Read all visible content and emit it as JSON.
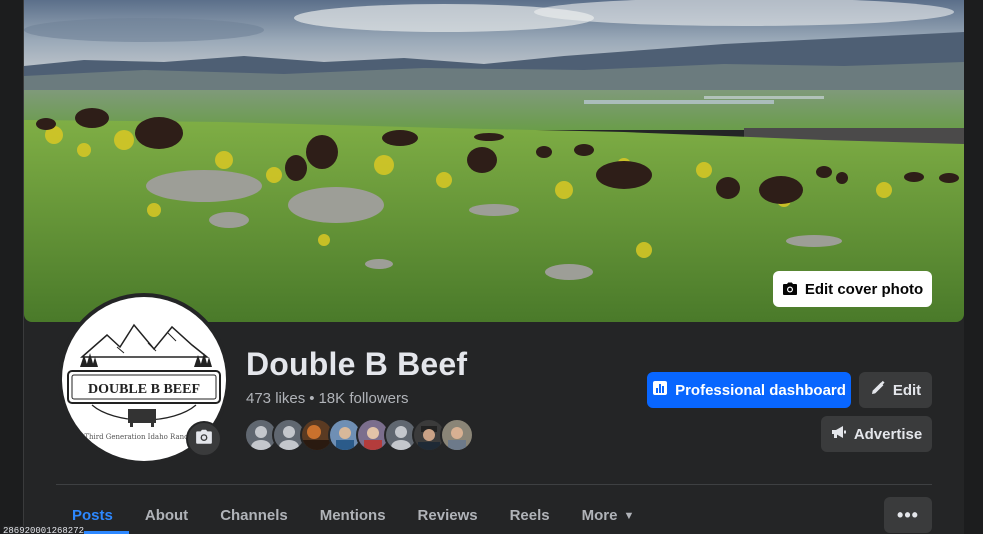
{
  "cover": {
    "edit_label": "Edit cover photo",
    "camera_icon": "camera-icon"
  },
  "profile": {
    "name": "Double B Beef",
    "likes": "473 likes",
    "separator": "•",
    "followers": "18K followers",
    "logo_text": "DOUBLE B BEEF",
    "logo_tagline": "Third Generation Idaho Ranchers",
    "avatar_camera_icon": "camera-icon"
  },
  "actions": {
    "dashboard_label": "Professional dashboard",
    "edit_label": "Edit",
    "advertise_label": "Advertise"
  },
  "tabs": [
    {
      "label": "Posts",
      "active": true
    },
    {
      "label": "About"
    },
    {
      "label": "Channels"
    },
    {
      "label": "Mentions"
    },
    {
      "label": "Reviews"
    },
    {
      "label": "Reels"
    },
    {
      "label": "More"
    }
  ],
  "more_menu": "•••",
  "corner_id": "286920001268272",
  "colors": {
    "background": "#242526",
    "primary": "#0866ff",
    "active_tab": "#2d88ff",
    "secondary_button": "#3a3b3c"
  }
}
